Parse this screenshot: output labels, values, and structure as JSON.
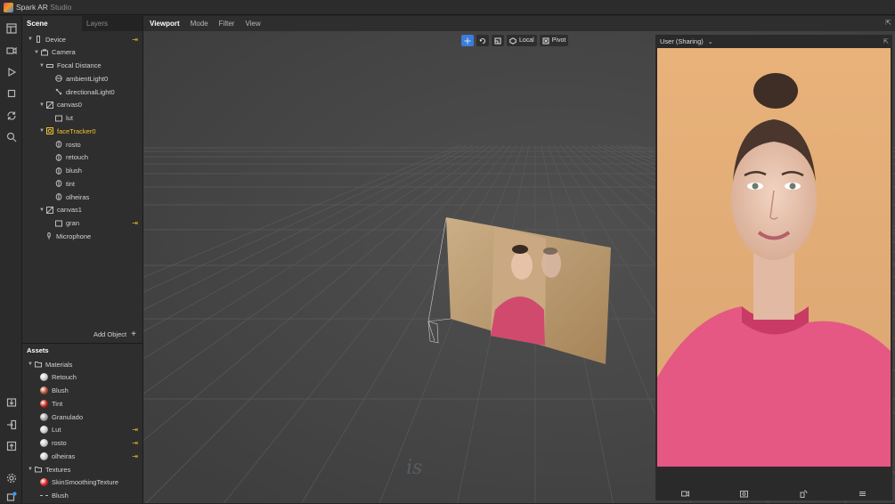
{
  "app": {
    "name": "Spark AR",
    "name_suffix": "Studio"
  },
  "left_panel": {
    "tabs": [
      "Scene",
      "Layers"
    ],
    "scene_tree": [
      {
        "label": "Device",
        "icon": "phone-icon",
        "arrow": "▼",
        "pinned": true
      },
      {
        "label": "Camera",
        "icon": "camera-icon",
        "arrow": "▼"
      },
      {
        "label": "Focal Distance",
        "icon": "focal-icon",
        "arrow": "▼"
      },
      {
        "label": "ambientLight0",
        "icon": "light-icon"
      },
      {
        "label": "directionalLight0",
        "icon": "directional-light-icon"
      },
      {
        "label": "canvas0",
        "icon": "canvas-icon",
        "arrow": "▼"
      },
      {
        "label": "lut",
        "icon": "rect-icon"
      },
      {
        "label": "faceTracker0",
        "icon": "face-tracker-icon",
        "arrow": "▼",
        "highlight": true
      },
      {
        "label": "rosto",
        "icon": "face-mesh-icon"
      },
      {
        "label": "retouch",
        "icon": "face-mesh-icon"
      },
      {
        "label": "blush",
        "icon": "face-mesh-icon"
      },
      {
        "label": "tint",
        "icon": "face-mesh-icon"
      },
      {
        "label": "olheiras",
        "icon": "face-mesh-icon"
      },
      {
        "label": "canvas1",
        "icon": "canvas-icon",
        "arrow": "▼"
      },
      {
        "label": "gran",
        "icon": "rect-icon",
        "pinned": true
      },
      {
        "label": "Microphone",
        "icon": "microphone-icon"
      }
    ],
    "add_object_label": "Add Object",
    "assets_title": "Assets",
    "assets": [
      {
        "label": "Materials",
        "type": "folder",
        "arrow": "▼"
      },
      {
        "label": "Retouch",
        "type": "material",
        "color": "#c9c9c9"
      },
      {
        "label": "Blush",
        "type": "material",
        "color": "#b3452a"
      },
      {
        "label": "Tint",
        "type": "material",
        "color": "#c41a12"
      },
      {
        "label": "Granulado",
        "type": "material",
        "color": "#9e9e9e"
      },
      {
        "label": "Lut",
        "type": "material",
        "color": "#c9c9c9",
        "pinned": true
      },
      {
        "label": "rosto",
        "type": "material",
        "color": "#c9c9c9",
        "pinned": true
      },
      {
        "label": "olheiras",
        "type": "material",
        "color": "#c9c9c9",
        "pinned": true
      },
      {
        "label": "Textures",
        "type": "folder",
        "arrow": "▼"
      },
      {
        "label": "SkinSmoothingTexture",
        "type": "texture",
        "color": "#e01b1b"
      },
      {
        "label": "Blush",
        "type": "texture-dash"
      }
    ],
    "pin_glyph": "⇥"
  },
  "viewport": {
    "menu": [
      "Viewport",
      "Mode",
      "Filter",
      "View"
    ],
    "tools": {
      "local_label": "Local",
      "pivot_label": "Pivot"
    },
    "simulator_device": "User (Sharing)",
    "watermark_text": "is"
  }
}
